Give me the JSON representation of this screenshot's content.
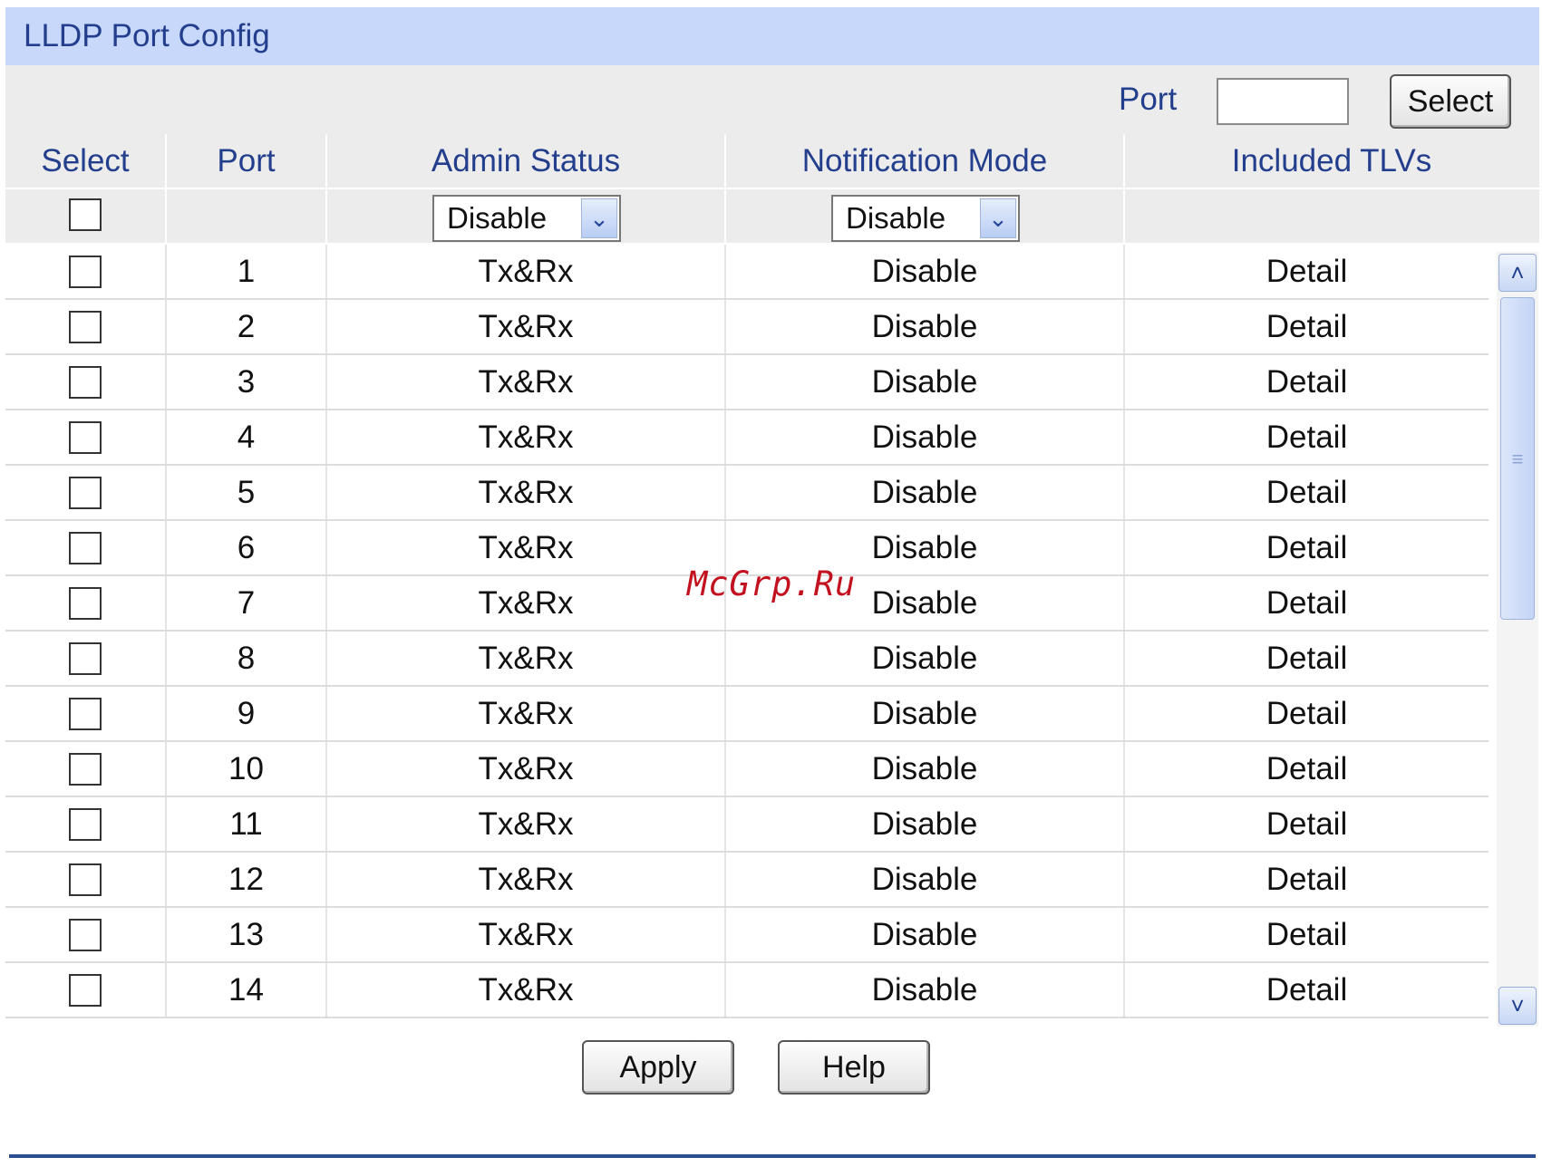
{
  "panel": {
    "title": "LLDP Port Config"
  },
  "search": {
    "label": "Port",
    "value": "",
    "placeholder": "",
    "button": "Select"
  },
  "table": {
    "headers": [
      "Select",
      "Port",
      "Admin Status",
      "Notification Mode",
      "Included TLVs"
    ],
    "bulk": {
      "admin_status": "Disable",
      "notification_mode": "Disable"
    },
    "rows": [
      {
        "port": "1",
        "admin": "Tx&Rx",
        "notify": "Disable",
        "tlv": "Detail"
      },
      {
        "port": "2",
        "admin": "Tx&Rx",
        "notify": "Disable",
        "tlv": "Detail"
      },
      {
        "port": "3",
        "admin": "Tx&Rx",
        "notify": "Disable",
        "tlv": "Detail"
      },
      {
        "port": "4",
        "admin": "Tx&Rx",
        "notify": "Disable",
        "tlv": "Detail"
      },
      {
        "port": "5",
        "admin": "Tx&Rx",
        "notify": "Disable",
        "tlv": "Detail"
      },
      {
        "port": "6",
        "admin": "Tx&Rx",
        "notify": "Disable",
        "tlv": "Detail"
      },
      {
        "port": "7",
        "admin": "Tx&Rx",
        "notify": "Disable",
        "tlv": "Detail"
      },
      {
        "port": "8",
        "admin": "Tx&Rx",
        "notify": "Disable",
        "tlv": "Detail"
      },
      {
        "port": "9",
        "admin": "Tx&Rx",
        "notify": "Disable",
        "tlv": "Detail"
      },
      {
        "port": "10",
        "admin": "Tx&Rx",
        "notify": "Disable",
        "tlv": "Detail"
      },
      {
        "port": "11",
        "admin": "Tx&Rx",
        "notify": "Disable",
        "tlv": "Detail"
      },
      {
        "port": "12",
        "admin": "Tx&Rx",
        "notify": "Disable",
        "tlv": "Detail"
      },
      {
        "port": "13",
        "admin": "Tx&Rx",
        "notify": "Disable",
        "tlv": "Detail"
      },
      {
        "port": "14",
        "admin": "Tx&Rx",
        "notify": "Disable",
        "tlv": "Detail"
      }
    ]
  },
  "actions": {
    "apply": "Apply",
    "help": "Help"
  },
  "watermark": "McGrp.Ru",
  "icons": {
    "dropdown": "chevron-down-icon",
    "scroll_up": "chevron-up-icon",
    "scroll_down": "chevron-down-icon"
  },
  "colors": {
    "title_bg": "#c7d8fb",
    "accent_text": "#233e8c",
    "link": "#3a6fd8",
    "footer_line": "#2c4d91"
  }
}
